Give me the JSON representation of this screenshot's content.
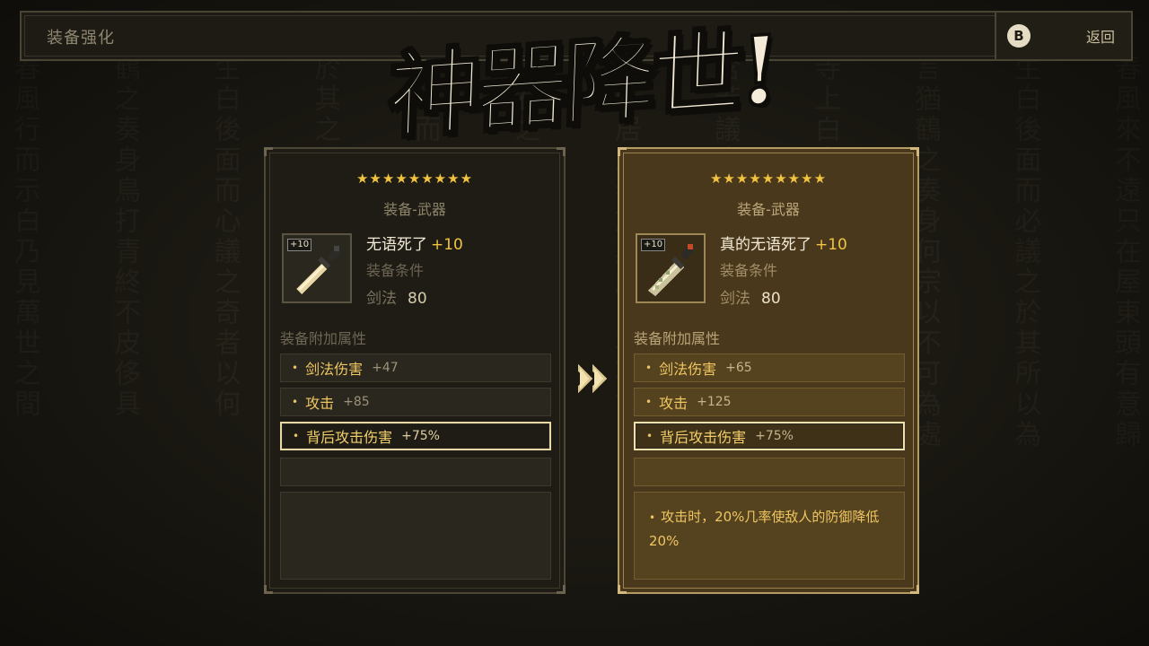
{
  "background_text": [
    "春風來不遠只在屋東頭有意歸",
    "生白後面而必議之於其所以為",
    "言猶鶴之奏身何宗以不可為處",
    "寺上白者石溪之余寧我者也",
    "含若議也之所以有為則存意",
    "心所居之者於其所以為不言",
    "而石之可以善人也心兵之所",
    "風行而示天地萬物之道其心",
    "於其之道若後之所以為天下",
    "生白後面而心議之奇者以何",
    "鶴之奏身鳥打青終不皮侈具",
    "春風行而示白乃見萬世之間"
  ],
  "header": {
    "title": "装备强化",
    "back_key": "B",
    "back_label": "返回"
  },
  "banner": {
    "text": "神器降世!"
  },
  "before": {
    "stars": "★★★★★★★★★",
    "category": "装备-武器",
    "level_badge": "+10",
    "name": "无语死了",
    "plus": "+10",
    "requirement_label": "装备条件",
    "requirement_skill": "剑法",
    "requirement_value": "80",
    "attr_heading": "装备附加属性",
    "attrs": [
      {
        "name": "剑法伤害",
        "value": "+47"
      },
      {
        "name": "攻击",
        "value": "+85"
      },
      {
        "name": "背后攻击伤害",
        "value": "+75%"
      }
    ]
  },
  "after": {
    "stars": "★★★★★★★★★",
    "category": "装备-武器",
    "level_badge": "+10",
    "name": "真的无语死了",
    "plus": "+10",
    "requirement_label": "装备条件",
    "requirement_skill": "剑法",
    "requirement_value": "80",
    "attr_heading": "装备附加属性",
    "attrs": [
      {
        "name": "剑法伤害",
        "value": "+65"
      },
      {
        "name": "攻击",
        "value": "+125"
      },
      {
        "name": "背后攻击伤害",
        "value": "+75%"
      }
    ],
    "special_effect": "攻击时，20%几率使敌人的防御降低20%"
  },
  "colors": {
    "accent_gold": "#efc662",
    "star_gold": "#f0c441",
    "upgraded_card_bg": "#4a381c"
  }
}
